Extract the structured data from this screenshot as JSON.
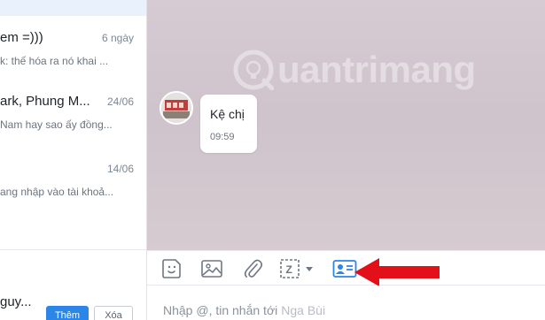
{
  "conversations": [
    {
      "name": "em =)))",
      "time": "6 ngày",
      "preview": "k: thế hóa ra nó khai ..."
    },
    {
      "name": "ark, Phung M...",
      "time": "24/06",
      "preview": "Nam hay sao ấy đồng..."
    },
    {
      "name": "",
      "time": "14/06",
      "preview": "ang nhập vào tài khoả..."
    }
  ],
  "suggestion": {
    "name": "guy...",
    "add_label": "Thêm",
    "delete_label": "Xóa"
  },
  "watermark": {
    "text": "uantrimang"
  },
  "message": {
    "text": "Kệ chị",
    "time": "09:59"
  },
  "toolbar": {
    "icons": [
      "emoji-icon",
      "image-icon",
      "attachment-icon",
      "screenshot-icon",
      "contact-card-icon"
    ],
    "screenshot_label": "Z"
  },
  "composer": {
    "placeholder": "Nhập @, tin nhắn tới",
    "recipient": "Nga Bùi"
  },
  "colors": {
    "accent": "#2b86e8",
    "arrow": "#e3101a",
    "chat_background": "#d2c7cf"
  }
}
